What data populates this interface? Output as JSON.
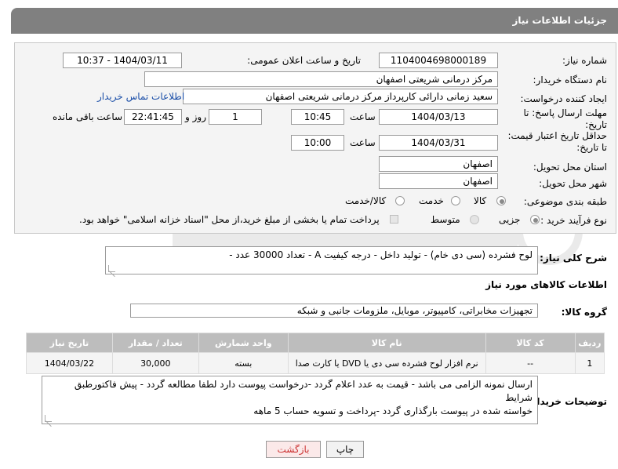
{
  "header": {
    "title": "جزئیات اطلاعات نیاز"
  },
  "form": {
    "need_number_label": "شماره نیاز:",
    "need_number": "1104004698000189",
    "announce_label": "تاریخ و ساعت اعلان عمومی:",
    "announce_value": "1404/03/11 - 10:37",
    "buyer_org_label": "نام دستگاه خریدار:",
    "buyer_org": "مرکز درمانی شریعتی اصفهان",
    "creator_label": "ایجاد کننده درخواست:",
    "creator": "سعید زمانی دارائی کارپرداز مرکز درمانی شریعتی اصفهان",
    "contact_link": "اطلاعات تماس خریدار",
    "deadline_label_1": "مهلت ارسال پاسخ: تا",
    "deadline_label_2": "تاریخ:",
    "deadline_date": "1404/03/13",
    "time_label": "ساعت",
    "deadline_time": "10:45",
    "days_value": "1",
    "days_label": "روز و",
    "remaining_time": "22:41:45",
    "remaining_label": "ساعت باقی مانده",
    "validity_label_1": "حداقل تاریخ اعتبار قیمت:",
    "validity_label_2": "تا تاریخ:",
    "validity_date": "1404/03/31",
    "validity_time": "10:00",
    "province_label": "استان محل تحویل:",
    "province": "اصفهان",
    "city_label": "شهر محل تحویل:",
    "city": "اصفهان",
    "category_label": "طبقه بندی موضوعی:",
    "category_options": [
      "کالا",
      "خدمت",
      "کالا/خدمت"
    ],
    "process_label": "نوع فرآیند خرید :",
    "process_options": [
      "جزیی",
      "متوسط"
    ],
    "payment_note": "پرداخت تمام یا بخشی از مبلغ خرید،از محل \"اسناد خزانه اسلامی\" خواهد بود."
  },
  "description": {
    "label": "شرح کلی نیاز:",
    "text": "لوح فشرده (سی دی خام) - تولید داخل - درجه کیفیت A - تعداد 30000 عدد -"
  },
  "goods": {
    "section_title": "اطلاعات کالاهای مورد نیاز",
    "group_label": "گروه کالا:",
    "group_value": "تجهیزات مخابراتی، کامپیوتر، موبایل، ملزومات جانبی و شبکه",
    "columns": [
      "ردیف",
      "کد کالا",
      "نام کالا",
      "واحد شمارش",
      "تعداد / مقدار",
      "تاریخ نیاز"
    ],
    "rows": [
      [
        "1",
        "--",
        "نرم افزار لوح فشرده سی دی یا DVD یا کارت صدا",
        "بسته",
        "30,000",
        "1404/03/22"
      ]
    ]
  },
  "buyer_notes": {
    "label": "توضیحات خریدار:",
    "line1": "ارسال نمونه الزامی می باشد - قیمت به عدد اعلام گردد -درخواست پیوست دارد لطفا مطالعه گردد - پیش فاکتورطبق شرایط",
    "line2": "خواسته شده در پیوست بارگذاری گردد -پرداخت و تسویه حساب  5 ماهه"
  },
  "buttons": {
    "print": "چاپ",
    "back": "بازگشت"
  },
  "colors": {
    "header_bg": "#808080",
    "back_button_text": "#cc3333",
    "link": "#1a4ea8"
  }
}
